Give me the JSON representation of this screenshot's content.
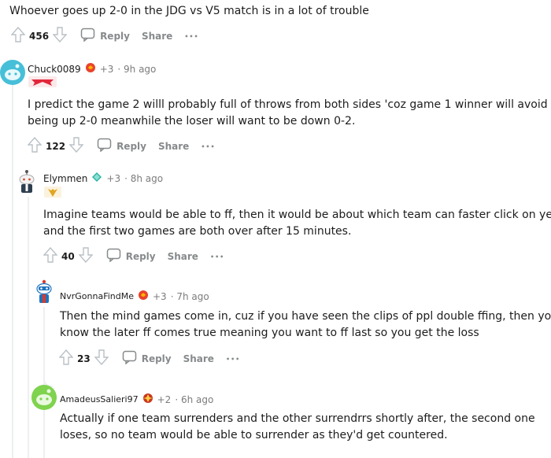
{
  "top_comment": {
    "text": "Whoever goes up 2-0 in the JDG vs V5 match is in a lot of trouble",
    "votes": "456",
    "reply_label": "Reply",
    "share_label": "Share",
    "more_label": "•••"
  },
  "comments": [
    {
      "username": "Chuck0089",
      "karma": "+3",
      "time": "· 9h ago",
      "lines": [
        "I predict the game 2 willl probably full of throws from both sides 'coz game 1 winner will avoid",
        "being up 2-0 meanwhile the loser will want to be down 0-2."
      ],
      "votes": "122",
      "reply_label": "Reply",
      "share_label": "Share",
      "more_label": "•••"
    },
    {
      "username": "Elymmen",
      "karma": "+3",
      "time": "· 8h ago",
      "lines": [
        "Imagine teams would be able to ff, then it would be about which team can faster click on yes",
        "and the first two games are both over after 15 minutes."
      ],
      "votes": "40",
      "reply_label": "Reply",
      "share_label": "Share",
      "more_label": "•••"
    },
    {
      "username": "NvrGonnaFindMe",
      "karma": "+3",
      "time": "· 7h ago",
      "lines": [
        "Then the mind games come in, cuz if you have seen the clips of ppl double ffing, then you",
        "know the later ff comes true meaning you want to ff last so you get the loss"
      ],
      "votes": "23",
      "reply_label": "Reply",
      "share_label": "Share",
      "more_label": "•••"
    },
    {
      "username": "AmadeusSalieri97",
      "karma": "+2",
      "time": "· 6h ago",
      "lines": [
        "Actually if one team surrenders and the other surrendrrs shortly after, the second one",
        "loses, so no team would be able to surrender as they'd get countered."
      ]
    }
  ],
  "colors": {
    "text": "#1c1c1c",
    "meta": "#7c7c7c",
    "action": "#878a8c",
    "thread": "#edeff1"
  },
  "icons": [
    "upvote-icon",
    "downvote-icon",
    "comment-bubble-icon",
    "more-options-icon",
    "team-flair-icon",
    "avatar-icon"
  ]
}
